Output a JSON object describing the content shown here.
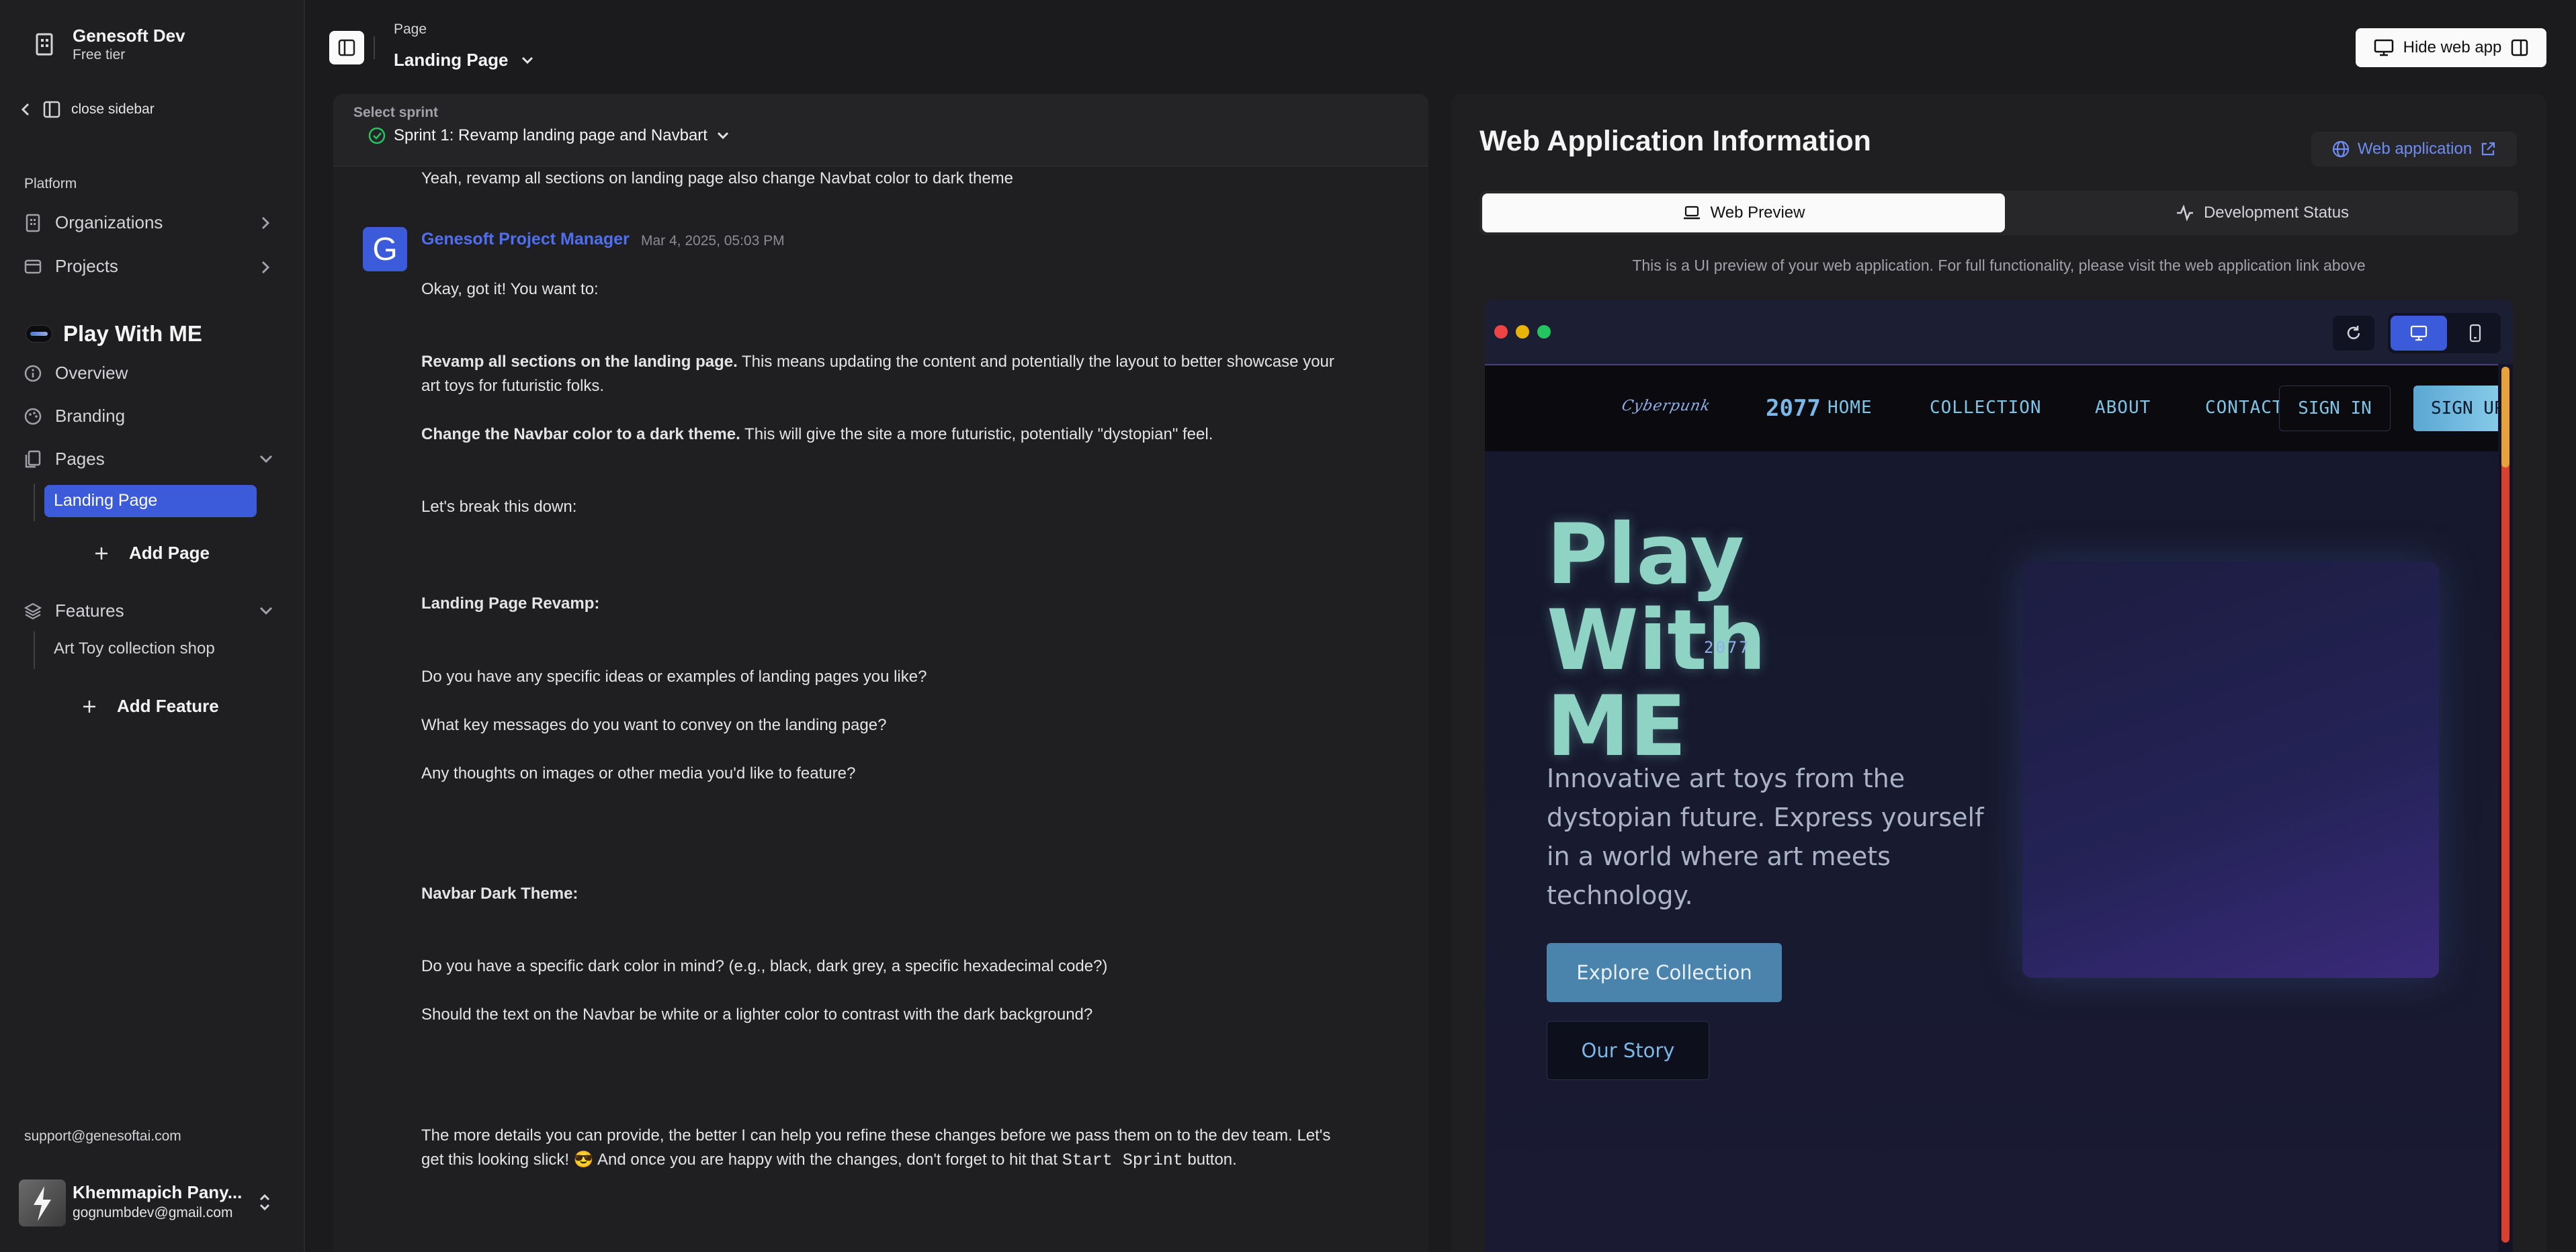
{
  "sidebar": {
    "org_name": "Genesoft Dev",
    "org_tier": "Free tier",
    "close_label": "close sidebar",
    "section_platform": "Platform",
    "organizations": "Organizations",
    "projects": "Projects",
    "project_name": "Play With ME",
    "overview": "Overview",
    "branding": "Branding",
    "pages": "Pages",
    "active_page": "Landing Page",
    "add_page": "Add Page",
    "features": "Features",
    "feature_item": "Art Toy collection shop",
    "add_feature": "Add Feature",
    "support_email": "support@genesoftai.com",
    "user_name": "Khemmapich Pany...",
    "user_email": "gognumbdev@gmail.com"
  },
  "header": {
    "crumb_label": "Page",
    "page_select": "Landing Page",
    "hide_web_app": "Hide web app"
  },
  "chat": {
    "sprint_label": "Select sprint",
    "sprint_value": "Sprint 1: Revamp landing page and Navbart",
    "prev_message": "Yeah, revamp all sections on landing page also change Navbat color to dark theme",
    "avatar_letter": "G",
    "sender": "Genesoft Project Manager",
    "timestamp": "Mar 4, 2025, 05:03 PM",
    "lines": {
      "l1": "Okay, got it! You want to:",
      "l2b": "Revamp all sections on the landing page.",
      "l2": " This means updating the content and potentially the layout to better showcase your",
      "l2c": "art toys for futuristic folks.",
      "l3b": "Change the Navbar color to a dark theme.",
      "l3": " This will give the site a more futuristic, potentially \"dystopian\" feel.",
      "l4": "Let's break this down:",
      "h1": "Landing Page Revamp:",
      "q1": "Do you have any specific ideas or examples of landing pages you like?",
      "q2": "What key messages do you want to convey on the landing page?",
      "q3": "Any thoughts on images or other media you'd like to feature?",
      "h2": "Navbar Dark Theme:",
      "q4": "Do you have a specific dark color in mind? (e.g., black, dark grey, a specific hexadecimal code?)",
      "q5": "Should the text on the Navbar be white or a lighter color to contrast with the dark background?",
      "end1": "The more details you can provide, the better I can help you refine these changes before we pass them on to the dev team. Let's",
      "end2a": "get this looking slick! 😎 And once you are happy with the changes, don't forget to hit that ",
      "end2code": "Start Sprint",
      "end2b": " button."
    }
  },
  "web_info": {
    "title": "Web Application Information",
    "link_label": "Web application",
    "tab_preview": "Web Preview",
    "tab_status": "Development Status",
    "note": "This is a UI preview of your web application. For full functionality, please visit the web application link above"
  },
  "preview": {
    "logo_text": "Cyberpunk",
    "year": "2077",
    "nav": [
      "HOME",
      "COLLECTION",
      "ABOUT",
      "CONTACT"
    ],
    "sign_in": "SIGN IN",
    "sign_up": "SIGN UP",
    "hero_line1": "Play",
    "hero_line2": "With",
    "hero_line3": "ME",
    "hero_sup": "2077",
    "hero_desc1": "Innovative art toys from the",
    "hero_desc2": "dystopian future. Express yourself",
    "hero_desc3": "in a world where art meets",
    "hero_desc4": "technology.",
    "cta_primary": "Explore Collection",
    "cta_secondary": "Our Story"
  },
  "colors": {
    "accent": "#3b5bdb",
    "link": "#6f8cf2",
    "preview_bg": "#13152a",
    "hero_text": "#8fd3c4"
  }
}
